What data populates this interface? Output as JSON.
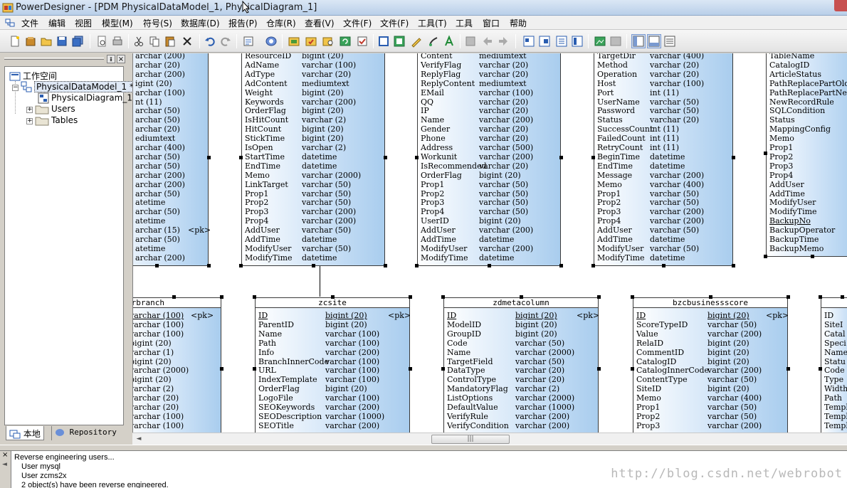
{
  "window": {
    "title": "PowerDesigner - [PDM PhysicalDataModel_1, PhysicalDiagram_1]"
  },
  "menu": [
    "文件",
    "编辑",
    "视图",
    "模型(M)",
    "符号(S)",
    "数据库(D)",
    "报告(P)",
    "仓库(R)",
    "查看(V)",
    "文件(F)",
    "文件(F)",
    "工具(T)",
    "工具",
    "窗口",
    "帮助"
  ],
  "browser": {
    "root": "工作空间",
    "model": "PhysicalDataModel_1 *",
    "diagram": "PhysicalDiagram_1",
    "folders": [
      "Users",
      "Tables"
    ],
    "tabs": [
      "本地",
      "Repository"
    ],
    "pin": "ᵻ",
    "close": "×"
  },
  "tables": {
    "t1": {
      "name": "",
      "rows": [
        {
          "c": "",
          "t": "archar (200)",
          "k": ""
        },
        {
          "c": "",
          "t": "archar (20)",
          "k": ""
        },
        {
          "c": "",
          "t": "archar (200)",
          "k": ""
        },
        {
          "c": "",
          "t": "igint (20)",
          "k": ""
        },
        {
          "c": "",
          "t": "archar (100)",
          "k": ""
        },
        {
          "c": "",
          "t": "nt (11)",
          "k": ""
        },
        {
          "c": "",
          "t": "archar (50)",
          "k": ""
        },
        {
          "c": "",
          "t": "archar (50)",
          "k": ""
        },
        {
          "c": "",
          "t": "archar (20)",
          "k": ""
        },
        {
          "c": "",
          "t": "ediumtext",
          "k": ""
        },
        {
          "c": "",
          "t": "archar (400)",
          "k": ""
        },
        {
          "c": "",
          "t": "archar (50)",
          "k": ""
        },
        {
          "c": "",
          "t": "archar (50)",
          "k": ""
        },
        {
          "c": "",
          "t": "archar (200)",
          "k": ""
        },
        {
          "c": "",
          "t": "archar (200)",
          "k": ""
        },
        {
          "c": "",
          "t": "archar (50)",
          "k": ""
        },
        {
          "c": "",
          "t": "atetime",
          "k": ""
        },
        {
          "c": "",
          "t": "archar (50)",
          "k": ""
        },
        {
          "c": "",
          "t": "atetime",
          "k": ""
        },
        {
          "c": "",
          "t": "archar (15)",
          "k": "<pk>"
        },
        {
          "c": "",
          "t": "archar (50)",
          "k": ""
        },
        {
          "c": "",
          "t": "atetime",
          "k": ""
        },
        {
          "c": "",
          "t": "archar (200)",
          "k": ""
        }
      ]
    },
    "t2": {
      "name": "",
      "rows": [
        {
          "c": "ResourceID",
          "t": "bigint (20)",
          "k": ""
        },
        {
          "c": "AdName",
          "t": "varchar (100)",
          "k": ""
        },
        {
          "c": "AdType",
          "t": "varchar (20)",
          "k": ""
        },
        {
          "c": "AdContent",
          "t": "mediumtext",
          "k": ""
        },
        {
          "c": "Weight",
          "t": "bigint (20)",
          "k": ""
        },
        {
          "c": "Keywords",
          "t": "varchar (200)",
          "k": ""
        },
        {
          "c": "OrderFlag",
          "t": "bigint (20)",
          "k": ""
        },
        {
          "c": "IsHitCount",
          "t": "varchar (2)",
          "k": ""
        },
        {
          "c": "HitCount",
          "t": "bigint (20)",
          "k": ""
        },
        {
          "c": "StickTime",
          "t": "bigint (20)",
          "k": ""
        },
        {
          "c": "IsOpen",
          "t": "varchar (2)",
          "k": ""
        },
        {
          "c": "StartTime",
          "t": "datetime",
          "k": ""
        },
        {
          "c": "EndTime",
          "t": "datetime",
          "k": ""
        },
        {
          "c": "Memo",
          "t": "varchar (2000)",
          "k": ""
        },
        {
          "c": "LinkTarget",
          "t": "varchar (50)",
          "k": ""
        },
        {
          "c": "Prop1",
          "t": "varchar (50)",
          "k": ""
        },
        {
          "c": "Prop2",
          "t": "varchar (50)",
          "k": ""
        },
        {
          "c": "Prop3",
          "t": "varchar (200)",
          "k": ""
        },
        {
          "c": "Prop4",
          "t": "varchar (200)",
          "k": ""
        },
        {
          "c": "AddUser",
          "t": "varchar (50)",
          "k": ""
        },
        {
          "c": "AddTime",
          "t": "datetime",
          "k": ""
        },
        {
          "c": "ModifyUser",
          "t": "varchar (50)",
          "k": ""
        },
        {
          "c": "ModifyTime",
          "t": "datetime",
          "k": ""
        }
      ]
    },
    "t3": {
      "name": "",
      "rows": [
        {
          "c": "Content",
          "t": "mediumtext",
          "k": ""
        },
        {
          "c": "VerifyFlag",
          "t": "varchar (20)",
          "k": ""
        },
        {
          "c": "ReplyFlag",
          "t": "varchar (20)",
          "k": ""
        },
        {
          "c": "ReplyContent",
          "t": "mediumtext",
          "k": ""
        },
        {
          "c": "EMail",
          "t": "varchar (100)",
          "k": ""
        },
        {
          "c": "QQ",
          "t": "varchar (20)",
          "k": ""
        },
        {
          "c": "IP",
          "t": "varchar (20)",
          "k": ""
        },
        {
          "c": "Name",
          "t": "varchar (200)",
          "k": ""
        },
        {
          "c": "Gender",
          "t": "varchar (20)",
          "k": ""
        },
        {
          "c": "Phone",
          "t": "varchar (20)",
          "k": ""
        },
        {
          "c": "Address",
          "t": "varchar (500)",
          "k": ""
        },
        {
          "c": "Workunit",
          "t": "varchar (200)",
          "k": ""
        },
        {
          "c": "IsRecommended",
          "t": "varchar (20)",
          "k": ""
        },
        {
          "c": "OrderFlag",
          "t": "bigint (20)",
          "k": ""
        },
        {
          "c": "Prop1",
          "t": "varchar (50)",
          "k": ""
        },
        {
          "c": "Prop2",
          "t": "varchar (50)",
          "k": ""
        },
        {
          "c": "Prop3",
          "t": "varchar (50)",
          "k": ""
        },
        {
          "c": "Prop4",
          "t": "varchar (50)",
          "k": ""
        },
        {
          "c": "UserID",
          "t": "bigint (20)",
          "k": ""
        },
        {
          "c": "AddUser",
          "t": "varchar (200)",
          "k": ""
        },
        {
          "c": "AddTime",
          "t": "datetime",
          "k": ""
        },
        {
          "c": "ModifyUser",
          "t": "varchar (200)",
          "k": ""
        },
        {
          "c": "ModifyTime",
          "t": "datetime",
          "k": ""
        }
      ]
    },
    "t4": {
      "name": "",
      "rows": [
        {
          "c": "TargetDir",
          "t": "varchar (400)",
          "k": ""
        },
        {
          "c": "Method",
          "t": "varchar (20)",
          "k": ""
        },
        {
          "c": "Operation",
          "t": "varchar (20)",
          "k": ""
        },
        {
          "c": "Host",
          "t": "varchar (100)",
          "k": ""
        },
        {
          "c": "Port",
          "t": "int (11)",
          "k": ""
        },
        {
          "c": "UserName",
          "t": "varchar (50)",
          "k": ""
        },
        {
          "c": "Password",
          "t": "varchar (50)",
          "k": ""
        },
        {
          "c": "Status",
          "t": "varchar (20)",
          "k": ""
        },
        {
          "c": "SuccessCount",
          "t": "int (11)",
          "k": ""
        },
        {
          "c": "FailedCount",
          "t": "int (11)",
          "k": ""
        },
        {
          "c": "RetryCount",
          "t": "int (11)",
          "k": ""
        },
        {
          "c": "BeginTime",
          "t": "datetime",
          "k": ""
        },
        {
          "c": "EndTime",
          "t": "datetime",
          "k": ""
        },
        {
          "c": "Message",
          "t": "varchar (200)",
          "k": ""
        },
        {
          "c": "Memo",
          "t": "varchar (400)",
          "k": ""
        },
        {
          "c": "Prop1",
          "t": "varchar (50)",
          "k": ""
        },
        {
          "c": "Prop2",
          "t": "varchar (50)",
          "k": ""
        },
        {
          "c": "Prop3",
          "t": "varchar (200)",
          "k": ""
        },
        {
          "c": "Prop4",
          "t": "varchar (200)",
          "k": ""
        },
        {
          "c": "AddUser",
          "t": "varchar (50)",
          "k": ""
        },
        {
          "c": "AddTime",
          "t": "datetime",
          "k": ""
        },
        {
          "c": "ModifyUser",
          "t": "varchar (50)",
          "k": ""
        },
        {
          "c": "ModifyTime",
          "t": "datetime",
          "k": ""
        }
      ]
    },
    "t5": {
      "name": "",
      "rows": [
        {
          "c": "TableName",
          "t": "",
          "k": ""
        },
        {
          "c": "CatalogID",
          "t": "",
          "k": ""
        },
        {
          "c": "ArticleStatus",
          "t": "",
          "k": ""
        },
        {
          "c": "PathReplacePartOld",
          "t": "",
          "k": ""
        },
        {
          "c": "PathReplacePartNew",
          "t": "",
          "k": ""
        },
        {
          "c": "NewRecordRule",
          "t": "",
          "k": ""
        },
        {
          "c": "SQLCondition",
          "t": "",
          "k": ""
        },
        {
          "c": "Status",
          "t": "",
          "k": ""
        },
        {
          "c": "MappingConfig",
          "t": "",
          "k": ""
        },
        {
          "c": "Memo",
          "t": "",
          "k": ""
        },
        {
          "c": "Prop1",
          "t": "",
          "k": ""
        },
        {
          "c": "Prop2",
          "t": "",
          "k": ""
        },
        {
          "c": "Prop3",
          "t": "",
          "k": ""
        },
        {
          "c": "Prop4",
          "t": "",
          "k": ""
        },
        {
          "c": "AddUser",
          "t": "",
          "k": ""
        },
        {
          "c": "AddTime",
          "t": "",
          "k": ""
        },
        {
          "c": "ModifyUser",
          "t": "",
          "k": ""
        },
        {
          "c": "ModifyTime",
          "t": "",
          "k": ""
        },
        {
          "c": "BackupNo",
          "t": "",
          "k": "",
          "pk": true
        },
        {
          "c": "BackupOperator",
          "t": "",
          "k": ""
        },
        {
          "c": "BackupTime",
          "t": "",
          "k": ""
        },
        {
          "c": "BackupMemo",
          "t": "",
          "k": ""
        }
      ]
    },
    "b1": {
      "name": "erbranch",
      "rows": [
        {
          "c": "",
          "t": "varchar (100)",
          "k": "<pk>",
          "pk": true
        },
        {
          "c": "",
          "t": "varchar (100)",
          "k": ""
        },
        {
          "c": "",
          "t": "varchar (100)",
          "k": ""
        },
        {
          "c": "",
          "t": "bigint (20)",
          "k": ""
        },
        {
          "c": "",
          "t": "varchar (1)",
          "k": ""
        },
        {
          "c": "",
          "t": "bigint (20)",
          "k": ""
        },
        {
          "c": "",
          "t": "varchar (2000)",
          "k": ""
        },
        {
          "c": "",
          "t": "bigint (20)",
          "k": ""
        },
        {
          "c": "",
          "t": "varchar (2)",
          "k": ""
        },
        {
          "c": "",
          "t": "varchar (20)",
          "k": ""
        },
        {
          "c": "",
          "t": "varchar (20)",
          "k": ""
        },
        {
          "c": "",
          "t": "varchar (100)",
          "k": ""
        },
        {
          "c": "",
          "t": "varchar (100)",
          "k": ""
        }
      ]
    },
    "b2": {
      "name": "zcsite",
      "rows": [
        {
          "c": "ID",
          "t": "bigint (20)",
          "k": "<pk>",
          "pk": true
        },
        {
          "c": "ParentID",
          "t": "bigint (20)",
          "k": ""
        },
        {
          "c": "Name",
          "t": "varchar (100)",
          "k": ""
        },
        {
          "c": "Path",
          "t": "varchar (100)",
          "k": ""
        },
        {
          "c": "Info",
          "t": "varchar (200)",
          "k": ""
        },
        {
          "c": "BranchInnerCode",
          "t": "varchar (100)",
          "k": ""
        },
        {
          "c": "URL",
          "t": "varchar (100)",
          "k": ""
        },
        {
          "c": "IndexTemplate",
          "t": "varchar (100)",
          "k": ""
        },
        {
          "c": "OrderFlag",
          "t": "bigint (20)",
          "k": ""
        },
        {
          "c": "LogoFile",
          "t": "varchar (100)",
          "k": ""
        },
        {
          "c": "SEOKeywords",
          "t": "varchar (200)",
          "k": ""
        },
        {
          "c": "SEODescription",
          "t": "varchar (1000)",
          "k": ""
        },
        {
          "c": "SEOTitle",
          "t": "varchar (200)",
          "k": ""
        }
      ]
    },
    "b3": {
      "name": "zdmetacolumn",
      "rows": [
        {
          "c": "ID",
          "t": "bigint (20)",
          "k": "<pk>",
          "pk": true
        },
        {
          "c": "ModelID",
          "t": "bigint (20)",
          "k": ""
        },
        {
          "c": "GroupID",
          "t": "bigint (20)",
          "k": ""
        },
        {
          "c": "Code",
          "t": "varchar (50)",
          "k": ""
        },
        {
          "c": "Name",
          "t": "varchar (2000)",
          "k": ""
        },
        {
          "c": "TargetField",
          "t": "varchar (50)",
          "k": ""
        },
        {
          "c": "DataType",
          "t": "varchar (20)",
          "k": ""
        },
        {
          "c": "ControlType",
          "t": "varchar (20)",
          "k": ""
        },
        {
          "c": "MandatoryFlag",
          "t": "varchar (2)",
          "k": ""
        },
        {
          "c": "ListOptions",
          "t": "varchar (2000)",
          "k": ""
        },
        {
          "c": "DefaultValue",
          "t": "varchar (1000)",
          "k": ""
        },
        {
          "c": "VerifyRule",
          "t": "varchar (200)",
          "k": ""
        },
        {
          "c": "VerifyCondition",
          "t": "varchar (200)",
          "k": ""
        }
      ]
    },
    "b4": {
      "name": "bzcbusinessscore",
      "rows": [
        {
          "c": "ID",
          "t": "bigint (20)",
          "k": "<pk>",
          "pk": true
        },
        {
          "c": "ScoreTypeID",
          "t": "varchar (50)",
          "k": ""
        },
        {
          "c": "Value",
          "t": "varchar (200)",
          "k": ""
        },
        {
          "c": "RelaID",
          "t": "bigint (20)",
          "k": ""
        },
        {
          "c": "CommentID",
          "t": "bigint (20)",
          "k": ""
        },
        {
          "c": "CatalogID",
          "t": "bigint (20)",
          "k": ""
        },
        {
          "c": "CatalogInnerCode",
          "t": "varchar (200)",
          "k": ""
        },
        {
          "c": "ContentType",
          "t": "varchar (50)",
          "k": ""
        },
        {
          "c": "SiteID",
          "t": "bigint (20)",
          "k": ""
        },
        {
          "c": "Memo",
          "t": "varchar (400)",
          "k": ""
        },
        {
          "c": "Prop1",
          "t": "varchar (50)",
          "k": ""
        },
        {
          "c": "Prop2",
          "t": "varchar (50)",
          "k": ""
        },
        {
          "c": "Prop3",
          "t": "varchar (200)",
          "k": ""
        }
      ]
    },
    "b5": {
      "name": "",
      "rows": [
        {
          "c": "ID",
          "t": "",
          "k": ""
        },
        {
          "c": "SiteI",
          "t": "",
          "k": ""
        },
        {
          "c": "Catal",
          "t": "",
          "k": ""
        },
        {
          "c": "Speci",
          "t": "",
          "k": ""
        },
        {
          "c": "Name",
          "t": "",
          "k": ""
        },
        {
          "c": "Statu",
          "t": "",
          "k": ""
        },
        {
          "c": "Code",
          "t": "",
          "k": ""
        },
        {
          "c": "Type",
          "t": "",
          "k": ""
        },
        {
          "c": "Width",
          "t": "",
          "k": ""
        },
        {
          "c": "Path",
          "t": "",
          "k": ""
        },
        {
          "c": "Templ",
          "t": "",
          "k": ""
        },
        {
          "c": "Templ",
          "t": "",
          "k": ""
        },
        {
          "c": "Templ",
          "t": "",
          "k": ""
        }
      ]
    }
  },
  "scrollbar": {
    "left": "◄",
    "thumb": "|||"
  },
  "output": {
    "side_close": "×",
    "side_arrow": "◄",
    "lines": [
      "Reverse engineering users...",
      "User mysql",
      "User zcms2x",
      "2 object(s) have been reverse engineered."
    ]
  },
  "watermark": "http://blog.csdn.net/webrobot"
}
